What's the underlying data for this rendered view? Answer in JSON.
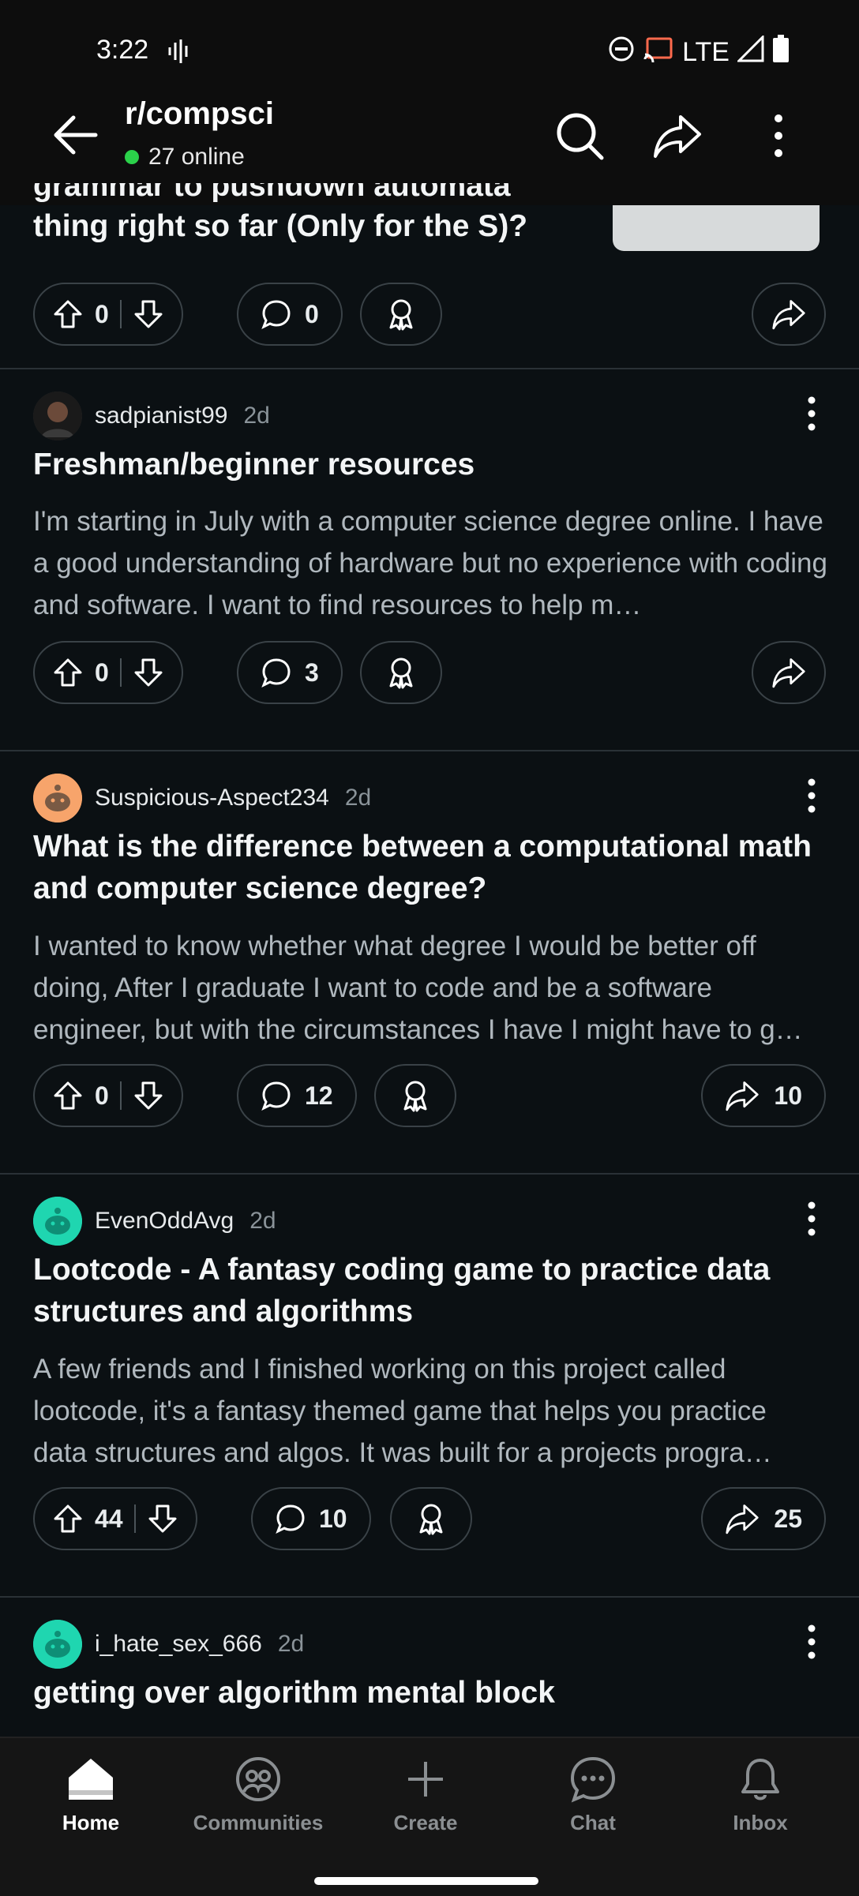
{
  "status": {
    "time": "3:22",
    "network": "LTE"
  },
  "header": {
    "subreddit": "r/compsci",
    "online": "27 online"
  },
  "partial_post": {
    "title_line1": "grammar to pushdown automata",
    "title_line2": "thing right so far (Only for the S)?",
    "upvotes": "0",
    "comments": "0"
  },
  "posts": [
    {
      "author": "sadpianist99",
      "age": "2d",
      "title": "Freshman/beginner resources",
      "body": "I'm starting in July with a computer science degree online. I have a good understanding of hardware but no experience with coding and software. I want to find resources to help m…",
      "upvotes": "0",
      "comments": "3",
      "shares": ""
    },
    {
      "author": "Suspicious-Aspect234",
      "age": "2d",
      "title": "What is the difference between a computational math and computer science degree?",
      "body": "I wanted to know whether what degree I would be better off doing, After I graduate I want to code and be a software engineer, but with the circumstances I have I might have to g…",
      "upvotes": "0",
      "comments": "12",
      "shares": "10"
    },
    {
      "author": "EvenOddAvg",
      "age": "2d",
      "title": "Lootcode - A fantasy coding game to practice data structures and algorithms",
      "body": "A few friends and I finished working on this project called lootcode, it's a fantasy themed game that helps you practice data structures and algos. It was built for a projects progra…",
      "upvotes": "44",
      "comments": "10",
      "shares": "25"
    },
    {
      "author": "i_hate_sex_666",
      "age": "2d",
      "title": "getting over algorithm mental block"
    }
  ],
  "nav": {
    "home": "Home",
    "communities": "Communities",
    "create": "Create",
    "chat": "Chat",
    "inbox": "Inbox"
  },
  "colors": {
    "online_dot": "#2bd14a",
    "background": "#0b1013",
    "accent_avatar_teal": "#1fd6b0",
    "accent_avatar_orange": "#f7a46b"
  }
}
